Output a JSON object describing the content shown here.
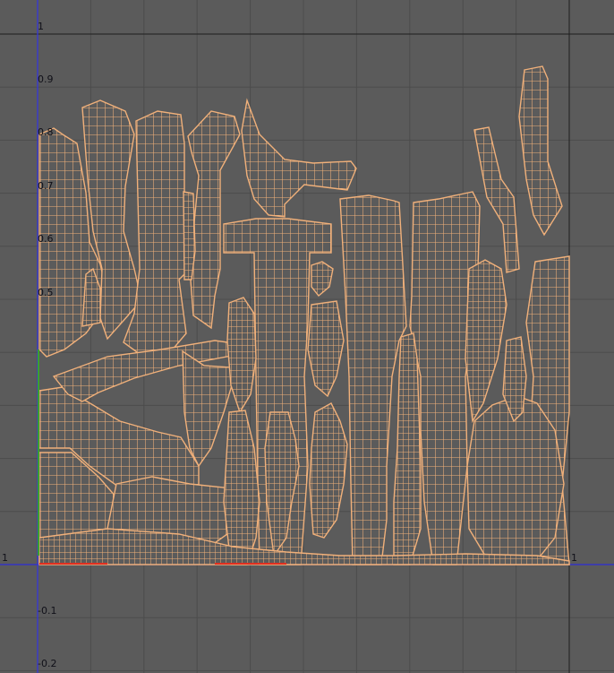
{
  "viewport": {
    "background_color": "#5b5b5b",
    "grid_color": "#4c4c4c",
    "major_line_color": "#1e1e1e",
    "u_axis_color": "#2c2cd6",
    "v_axis_color": "#3434e0",
    "uv_wire_color": "#f0b07a",
    "u_range": [
      0,
      1
    ],
    "v_range": [
      -0.2,
      1
    ],
    "grid_step": 0.1
  },
  "axis_labels": {
    "v_top": "1",
    "v_09": "0.9",
    "v_08": "0.8",
    "v_07": "0.7",
    "v_06": "0.6",
    "v_05": "0.5",
    "origin_left": "1",
    "right_one": "1",
    "v_neg01": "-0.1",
    "v_neg02": "-0.2"
  }
}
